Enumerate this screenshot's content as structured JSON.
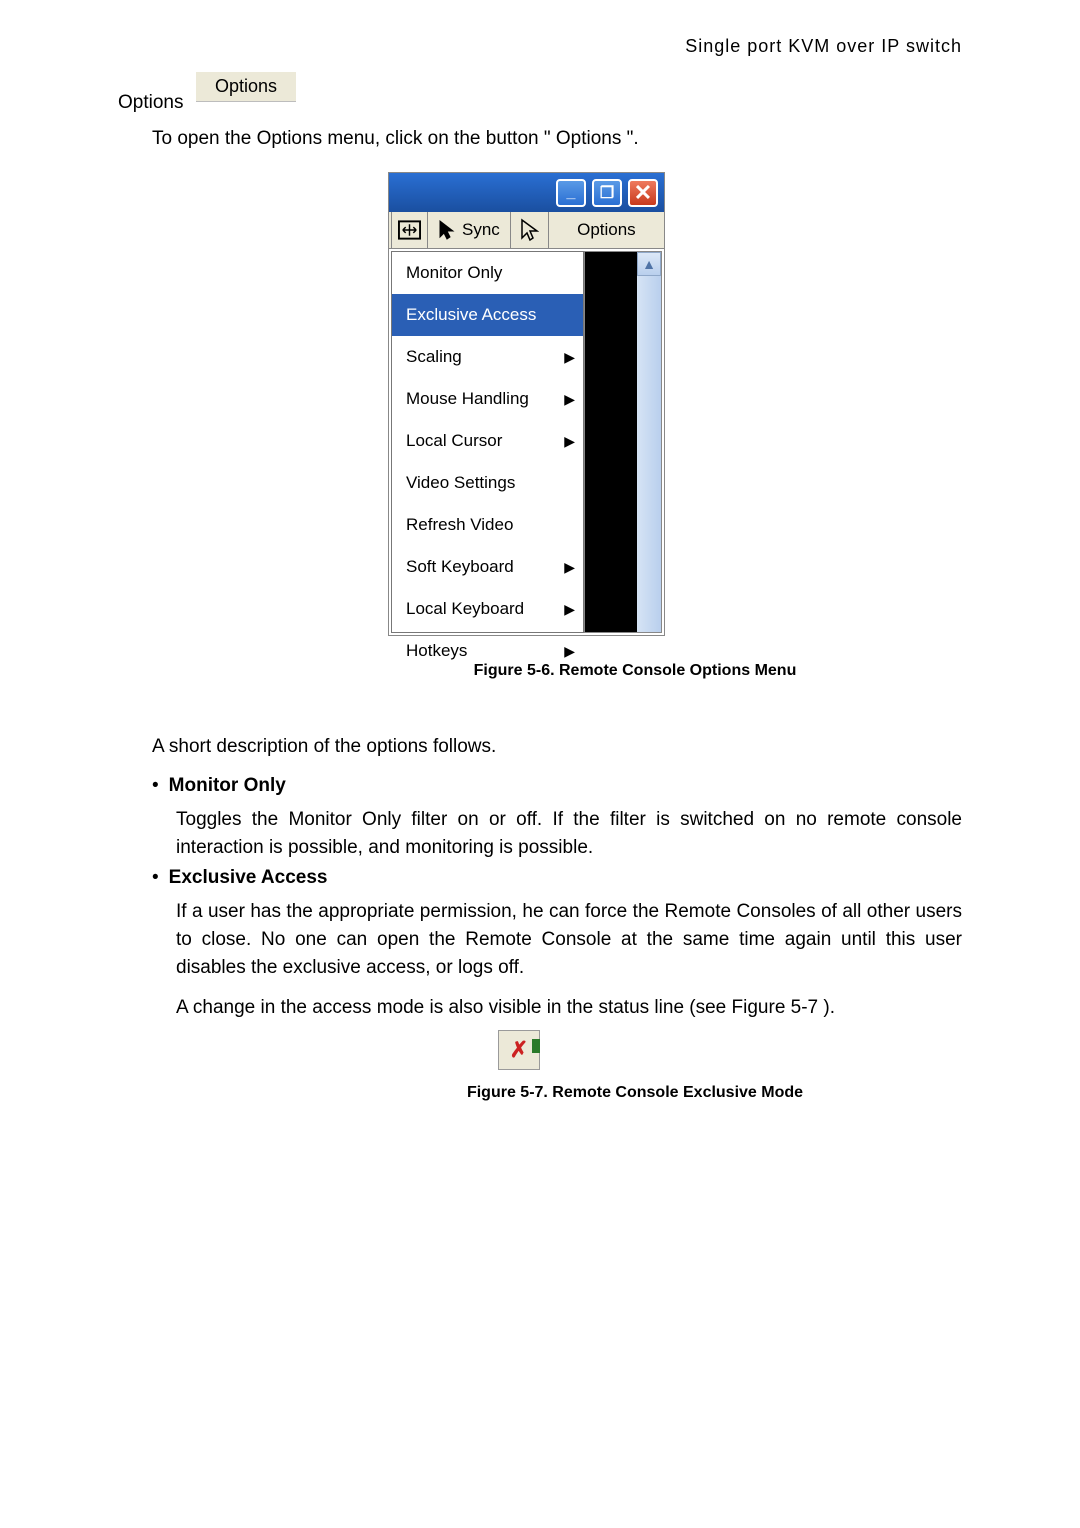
{
  "header": {
    "title": "Single port KVM over IP switch"
  },
  "section": {
    "label": "Options",
    "chip": "Options",
    "intro": "To open the Options menu, click on the button \" Options \"."
  },
  "rc": {
    "titlebar": {
      "minimize": "_",
      "restore": "❐",
      "close": "✕"
    },
    "toolbar": {
      "sync": "Sync",
      "options": "Options"
    },
    "menu": {
      "items": [
        {
          "label": "Monitor Only",
          "submenu": false,
          "selected": false
        },
        {
          "label": "Exclusive Access",
          "submenu": false,
          "selected": true
        },
        {
          "label": "Scaling",
          "submenu": true,
          "selected": false
        },
        {
          "label": "Mouse Handling",
          "submenu": true,
          "selected": false
        },
        {
          "label": "Local Cursor",
          "submenu": true,
          "selected": false
        },
        {
          "label": "Video Settings",
          "submenu": false,
          "selected": false
        },
        {
          "label": "Refresh Video",
          "submenu": false,
          "selected": false
        },
        {
          "label": "Soft Keyboard",
          "submenu": true,
          "selected": false
        },
        {
          "label": "Local Keyboard",
          "submenu": true,
          "selected": false
        },
        {
          "label": "Hotkeys",
          "submenu": true,
          "selected": false
        }
      ]
    }
  },
  "captions": {
    "fig1": "Figure 5-6. Remote Console Options Menu",
    "fig2": "Figure 5-7. Remote Console Exclusive Mode"
  },
  "desc": {
    "short": "A short description of the options follows.",
    "monitor_only": {
      "title": "Monitor Only",
      "body": "Toggles the Monitor Only filter on or off. If the filter is switched on no remote console interaction is possible, and monitoring is possible."
    },
    "exclusive": {
      "title": "Exclusive Access",
      "body1": "If a user has the appropriate permission, he can force the Remote Consoles of all other users to close. No one can open the Remote Console at the same time again until this user disables the exclusive access, or logs off.",
      "body2": "A change in the access mode is also visible in the status line (see Figure 5-7 )."
    }
  },
  "icons": {
    "excl_x": "✗"
  }
}
